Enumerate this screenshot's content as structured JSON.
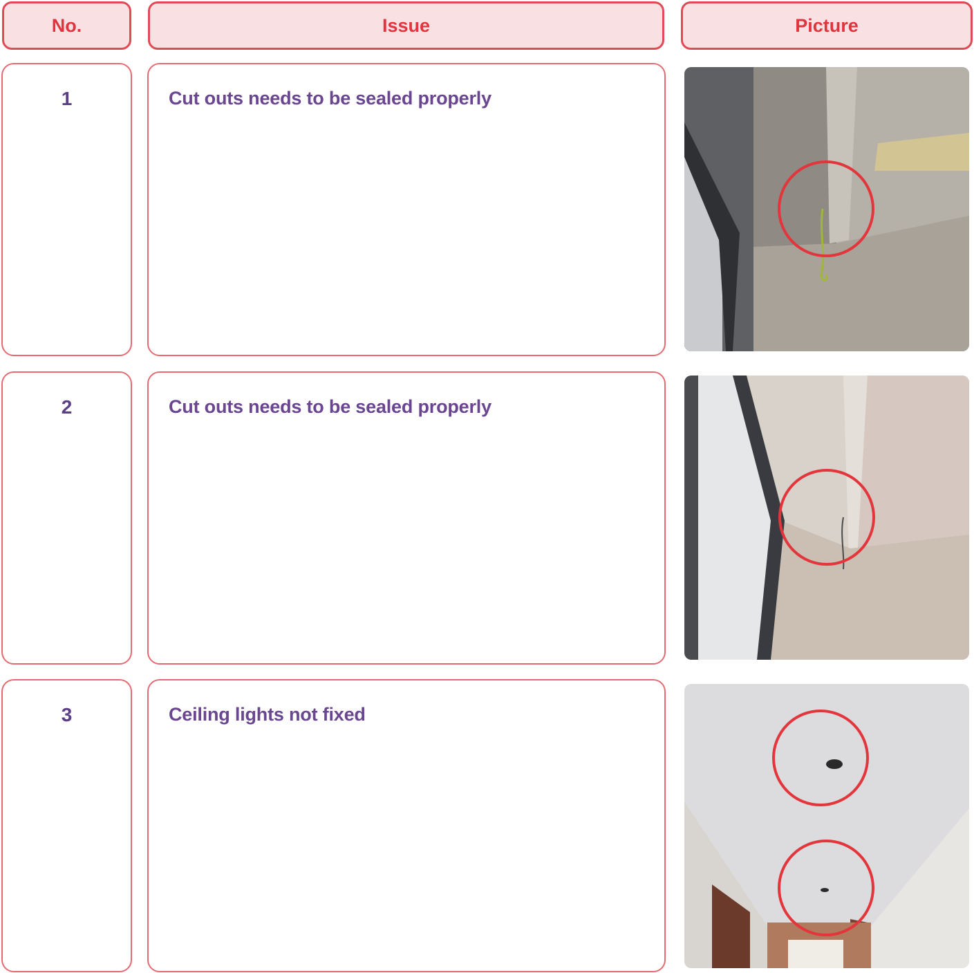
{
  "table": {
    "headers": {
      "no": "No.",
      "issue": "Issue",
      "picture": "Picture"
    },
    "rows": [
      {
        "no": "1",
        "issue": "Cut outs needs to be sealed properly",
        "photo": "window-corner-exposed-wire-photo"
      },
      {
        "no": "2",
        "issue": "Cut outs needs to be sealed properly",
        "photo": "window-beam-cutout-photo"
      },
      {
        "no": "3",
        "issue": "Ceiling lights not fixed",
        "photo": "corridor-ceiling-holes-photo"
      }
    ]
  },
  "colors": {
    "header_border": "#e04a54",
    "header_fill": "#f9e1e3",
    "header_text": "#e0343f",
    "cell_border": "#e56a72",
    "body_text": "#6a4590",
    "highlight_circle": "#e2363c"
  }
}
